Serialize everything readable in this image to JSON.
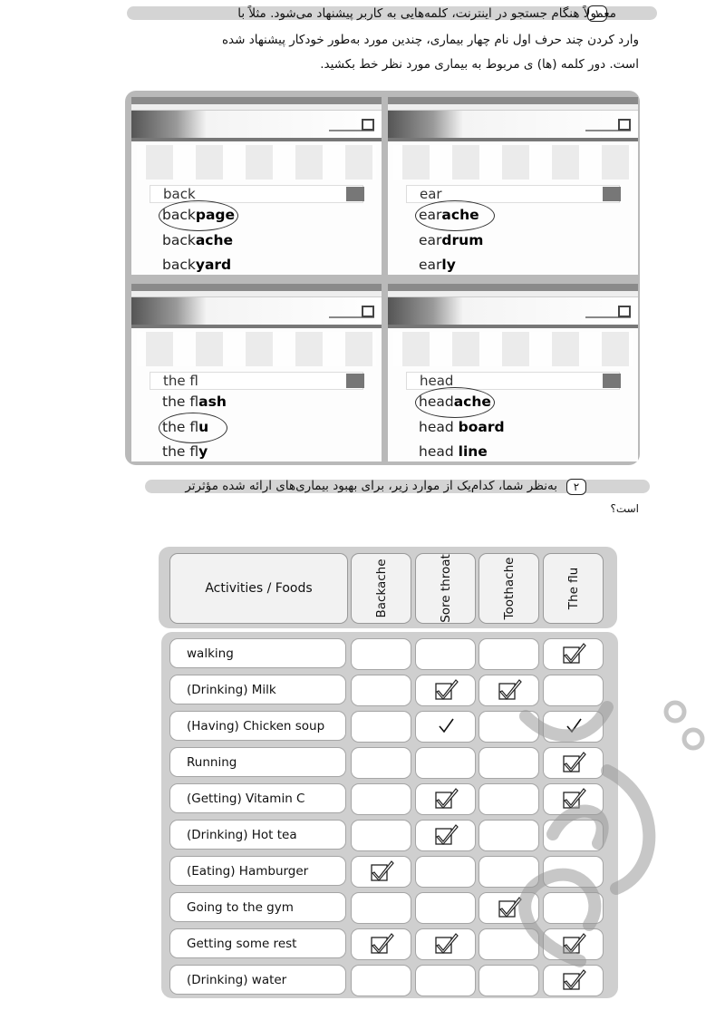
{
  "exercise1": {
    "number": "۱",
    "lines": [
      "معمولاً هنگام جستجو در اینترنت، کلمه‌هایی به کاربر پیشنهاد می‌شود. مثلاً با",
      "وارد کردن چند حرف اول نام چهار بیماری، چندین مورد به‌طور خودکار پیشنهاد شده",
      "است. دور کلمه (ها) ی مربوط به بیماری مورد نظر خط بکشید."
    ],
    "screenshots": [
      {
        "query": "back",
        "suggestions": [
          {
            "prefix": "back",
            "suffix": "page"
          },
          {
            "prefix": "back",
            "suffix": "ache"
          },
          {
            "prefix": "back",
            "suffix": "yard"
          }
        ],
        "circled": 0
      },
      {
        "query": "ear",
        "suggestions": [
          {
            "prefix": "ear",
            "suffix": "ache"
          },
          {
            "prefix": "ear",
            "suffix": "drum"
          },
          {
            "prefix": "ear",
            "suffix": "ly"
          }
        ],
        "circled": 0
      },
      {
        "query": "the fl",
        "suggestions": [
          {
            "prefix": "the fl",
            "suffix": "ash"
          },
          {
            "prefix": "the fl",
            "suffix": "u"
          },
          {
            "prefix": "the fl",
            "suffix": "y"
          }
        ],
        "circled": 1
      },
      {
        "query": "head",
        "suggestions": [
          {
            "prefix": "head",
            "suffix": "ache"
          },
          {
            "prefix": "head ",
            "suffix": "board"
          },
          {
            "prefix": "head ",
            "suffix": "line"
          }
        ],
        "circled": 0
      }
    ]
  },
  "exercise2": {
    "number": "۲",
    "lines": [
      "به‌نظر شما، کدام‌یک از موارد زیر، برای بهبود بیماری‌های ارائه شده مؤثرتر",
      "است؟"
    ],
    "table": {
      "header": "Activities / Foods",
      "columns": [
        "Backache",
        "Sore throat",
        "Toothache",
        "The flu"
      ],
      "rows": [
        {
          "label": "walking",
          "marks": [
            "",
            "",
            "",
            "box"
          ]
        },
        {
          "label": "(Drinking) Milk",
          "marks": [
            "",
            "box",
            "box",
            ""
          ]
        },
        {
          "label": "(Having) Chicken soup",
          "marks": [
            "",
            "tick",
            "",
            "tick"
          ]
        },
        {
          "label": "Running",
          "marks": [
            "",
            "",
            "",
            "box"
          ]
        },
        {
          "label": "(Getting) Vitamin C",
          "marks": [
            "",
            "box",
            "",
            "box"
          ]
        },
        {
          "label": "(Drinking) Hot tea",
          "marks": [
            "",
            "box",
            "",
            ""
          ]
        },
        {
          "label": "(Eating) Hamburger",
          "marks": [
            "box",
            "",
            "",
            ""
          ]
        },
        {
          "label": "Going to the gym",
          "marks": [
            "",
            "",
            "box",
            ""
          ]
        },
        {
          "label": "Getting some rest",
          "marks": [
            "box",
            "box",
            "",
            "box"
          ]
        },
        {
          "label": "(Drinking) water",
          "marks": [
            "",
            "",
            "",
            "box"
          ]
        }
      ]
    }
  },
  "watermark": "logo"
}
